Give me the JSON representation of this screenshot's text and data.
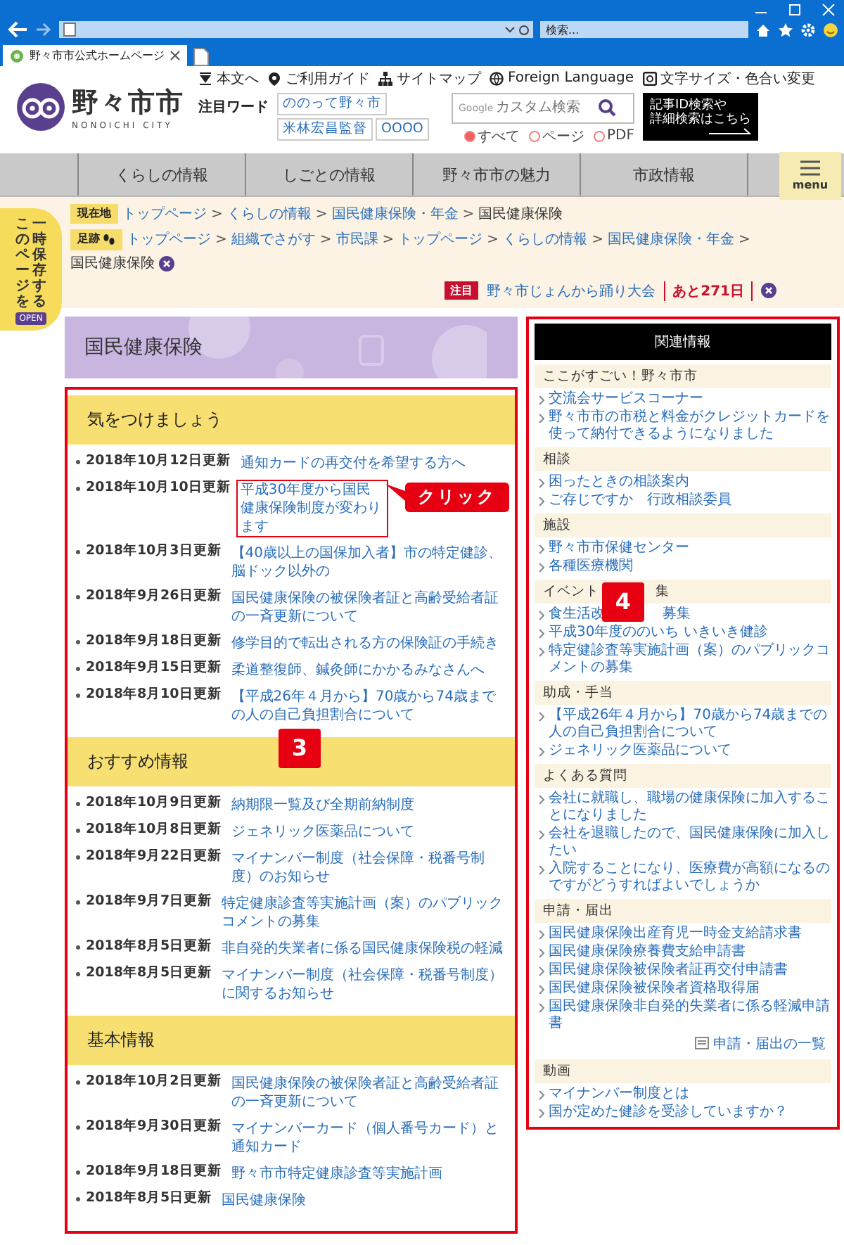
{
  "browser": {
    "search_placeholder": "検索...",
    "tab": {
      "title": "野々市市公式ホームページ"
    }
  },
  "header": {
    "logo": {
      "name": "野々市市",
      "romaji": "NONOICHI CITY"
    },
    "utility_links": [
      {
        "kind": "skip",
        "label": "本文へ"
      },
      {
        "kind": "guide",
        "label": "ご利用ガイド"
      },
      {
        "kind": "sitemap",
        "label": "サイトマップ"
      },
      {
        "kind": "language",
        "label": "Foreign Language"
      },
      {
        "kind": "display",
        "label": "文字サイズ・色合い変更"
      }
    ],
    "keywords_label": "注目ワード",
    "keywords": [
      "ののって野々市",
      "米林宏昌監督",
      "OOOO"
    ],
    "search": {
      "brand": "Google",
      "placeholder": "カスタム検索"
    },
    "search_scope": [
      {
        "label": "すべて",
        "selected": true
      },
      {
        "label": "ページ",
        "selected": false
      },
      {
        "label": "PDF",
        "selected": false
      }
    ],
    "detail_search": {
      "lines": [
        "記事ID検索や",
        "詳細検索はこちら"
      ]
    }
  },
  "nav": {
    "items": [
      "くらしの情報",
      "しごとの情報",
      "野々市市の魅力",
      "市政情報"
    ],
    "menu_label": "menu"
  },
  "breadcrumbs": {
    "separator": ">",
    "trails": [
      {
        "label": "現在地",
        "kind": "current",
        "path": [
          "トップページ",
          "くらしの情報",
          "国民健康保険・年金",
          "国民健康保険"
        ]
      },
      {
        "label": "足跡",
        "kind": "history",
        "path": [
          "トップページ",
          "組織でさがす",
          "市民課",
          "トップページ",
          "くらしの情報",
          "国民健康保険・年金",
          "国民健康保険"
        ]
      }
    ]
  },
  "notice": {
    "badge": "注目",
    "text": "野々市じょんから踊り大会",
    "countdown": "あと271日"
  },
  "save_tab": {
    "lines": [
      "このページを",
      "一時保存する"
    ],
    "button": "OPEN"
  },
  "page_title": "国民健康保険",
  "main_marker": "3",
  "callout": "クリック",
  "sections": [
    {
      "heading": "気をつけましょう",
      "items": [
        {
          "date": "2018年10月12日更新",
          "title": "通知カードの再交付を希望する方へ",
          "highlighted": false
        },
        {
          "date": "2018年10月10日更新",
          "title": "平成30年度から国民健康保険制度が変わります",
          "highlighted": true
        },
        {
          "date": "2018年10月3日更新",
          "title": "【40歳以上の国保加入者】市の特定健診、脳ドック以外の",
          "highlighted": false
        },
        {
          "date": "2018年9月26日更新",
          "title": "国民健康保険の被保険者証と高齢受給者証の一斉更新について",
          "highlighted": false
        },
        {
          "date": "2018年9月18日更新",
          "title": "修学目的で転出される方の保険証の手続き",
          "highlighted": false
        },
        {
          "date": "2018年9月15日更新",
          "title": "柔道整復師、鍼灸師にかかるみなさんへ",
          "highlighted": false
        },
        {
          "date": "2018年8月10日更新",
          "title": "【平成26年４月から】70歳から74歳までの人の自己負担割合について",
          "highlighted": false
        }
      ]
    },
    {
      "heading": "おすすめ情報",
      "items": [
        {
          "date": "2018年10月9日更新",
          "title": "納期限一覧及び全期前納制度",
          "highlighted": false
        },
        {
          "date": "2018年10月8日更新",
          "title": "ジェネリック医薬品について",
          "highlighted": false
        },
        {
          "date": "2018年9月22日更新",
          "title": "マイナンバー制度（社会保障・税番号制度）のお知らせ",
          "highlighted": false
        },
        {
          "date": "2018年9月7日更新",
          "title": "特定健康診査等実施計画（案）のパブリックコメントの募集",
          "highlighted": false
        },
        {
          "date": "2018年8月5日更新",
          "title": "非自発的失業者に係る国民健康保険税の軽減",
          "highlighted": false
        },
        {
          "date": "2018年8月5日更新",
          "title": "マイナンバー制度（社会保障・税番号制度）に関するお知らせ",
          "highlighted": false
        }
      ]
    },
    {
      "heading": "基本情報",
      "items": [
        {
          "date": "2018年10月2日更新",
          "title": "国民健康保険の被保険者証と高齢受給者証の一斉更新について",
          "highlighted": false
        },
        {
          "date": "2018年9月30日更新",
          "title": "マイナンバーカード（個人番号カード）と通知カード",
          "highlighted": false
        },
        {
          "date": "2018年9月18日更新",
          "title": "野々市市特定健康診査等実施計画",
          "highlighted": false
        },
        {
          "date": "2018年8月5日更新",
          "title": "国民健康保険",
          "highlighted": false
        }
      ]
    }
  ],
  "related": {
    "title": "関連情報",
    "marker": "4",
    "groups": [
      {
        "heading": [
          "ここがすごい！野々市市"
        ],
        "marked": false,
        "links": [
          [
            "交流会サービスコーナー"
          ],
          [
            "野々市市の市税と料金がクレジットカードを使って納付できるようになりました"
          ]
        ]
      },
      {
        "heading": [
          "相談"
        ],
        "marked": false,
        "links": [
          [
            "困ったときの相談案内"
          ],
          [
            "ご存じですか　行政相談委員"
          ]
        ]
      },
      {
        "heading": [
          "施設"
        ],
        "marked": false,
        "links": [
          [
            "野々市市保健センター"
          ],
          [
            "各種医療機関"
          ]
        ]
      },
      {
        "heading": [
          "イベント",
          "集"
        ],
        "marked": true,
        "links": [
          [
            "食生活改",
            "募集"
          ],
          [
            "平成30年度ののいち いきいき健診"
          ],
          [
            "特定健診査等実施計画（案）のパブリックコメントの募集"
          ]
        ]
      },
      {
        "heading": [
          "助成・手当"
        ],
        "marked": false,
        "links": [
          [
            "【平成26年４月から】70歳から74歳までの人の自己負担割合について"
          ],
          [
            "ジェネリック医薬品について"
          ]
        ]
      },
      {
        "heading": [
          "よくある質問"
        ],
        "marked": false,
        "links": [
          [
            "会社に就職し、職場の健康保険に加入することになりました"
          ],
          [
            "会社を退職したので、国民健康保険に加入したい"
          ],
          [
            "入院することになり、医療費が高額になるのですがどうすればよいでしょうか"
          ]
        ]
      },
      {
        "heading": [
          "申請・届出"
        ],
        "marked": false,
        "links": [
          [
            "国民健康保険出産育児一時金支給請求書"
          ],
          [
            "国民健康保険療養費支給申請書"
          ],
          [
            "国民健康保険被保険者証再交付申請書"
          ],
          [
            "国民健康保険被保険者資格取得届"
          ],
          [
            "国民健康保険非自発的失業者に係る軽減申請書"
          ]
        ],
        "more": "申請・届出の一覧"
      },
      {
        "heading": [
          "動画"
        ],
        "marked": false,
        "links": [
          [
            "マイナンバー制度とは"
          ],
          [
            "国が定めた健診を受診していますか？"
          ]
        ]
      }
    ]
  }
}
